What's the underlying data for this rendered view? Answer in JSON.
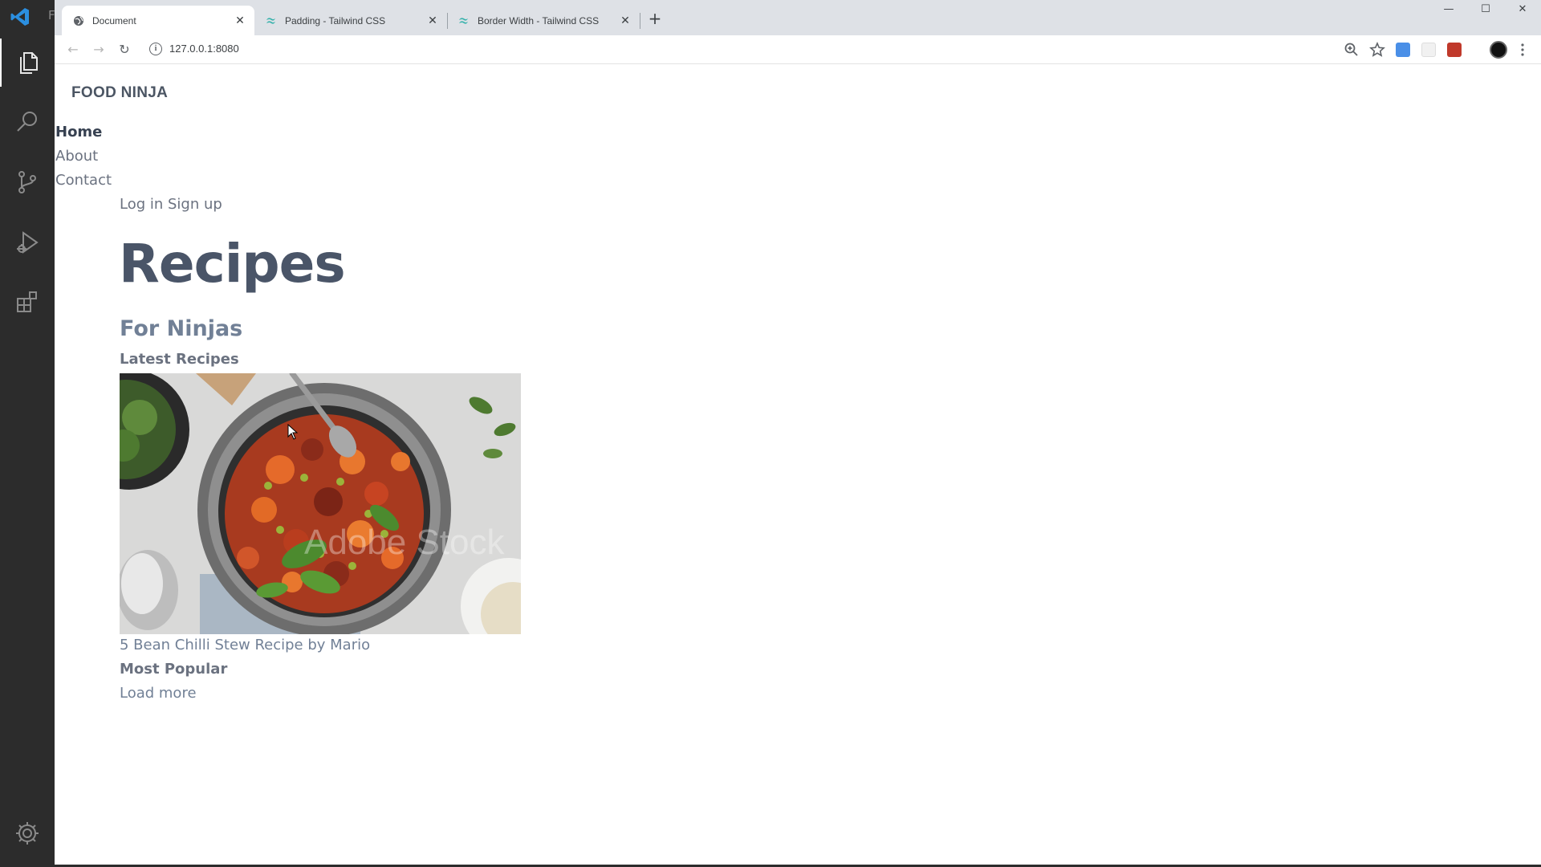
{
  "editor": {
    "title_fragment": "F",
    "activity_items": [
      {
        "icon": "files-icon"
      },
      {
        "icon": "search-icon"
      },
      {
        "icon": "source-control-icon"
      },
      {
        "icon": "run-debug-icon"
      },
      {
        "icon": "extensions-icon"
      },
      {
        "icon": "settings-gear-icon"
      }
    ]
  },
  "browser": {
    "tabs": [
      {
        "title": "Document",
        "active": true,
        "icon": "globe-icon"
      },
      {
        "title": "Padding - Tailwind CSS",
        "active": false,
        "icon": "tailwind-icon"
      },
      {
        "title": "Border Width - Tailwind CSS",
        "active": false,
        "icon": "tailwind-icon"
      }
    ],
    "tab_close_glyph": "✕",
    "new_tab_glyph": "+",
    "window_controls": {
      "minimize": "—",
      "maximize": "☐",
      "close": "✕"
    },
    "url": "127.0.0.1:8080",
    "nav": {
      "back": "←",
      "forward": "→",
      "reload": "↻"
    },
    "toolbar_icons": [
      "zoom-icon",
      "bookmark-star-icon",
      "extension-icon",
      "pdf-icon",
      "profile-avatar",
      "menu-icon"
    ],
    "colors": {
      "tabstrip": "#dee1e6",
      "ext_blue": "#4a8fe7",
      "pdf_red": "#c0392b"
    }
  },
  "page": {
    "site_title": "FOOD NINJA",
    "nav": [
      {
        "label": "Home",
        "active": true
      },
      {
        "label": "About",
        "active": false
      },
      {
        "label": "Contact",
        "active": false
      }
    ],
    "auth_text": "Log in Sign up",
    "heading": "Recipes",
    "subheading": "For Ninjas",
    "latest_title": "Latest Recipes",
    "card": {
      "caption": "5 Bean Chilli Stew Recipe by Mario",
      "watermark": "Adobe Stock"
    },
    "popular_title": "Most Popular",
    "load_more": "Load more"
  }
}
